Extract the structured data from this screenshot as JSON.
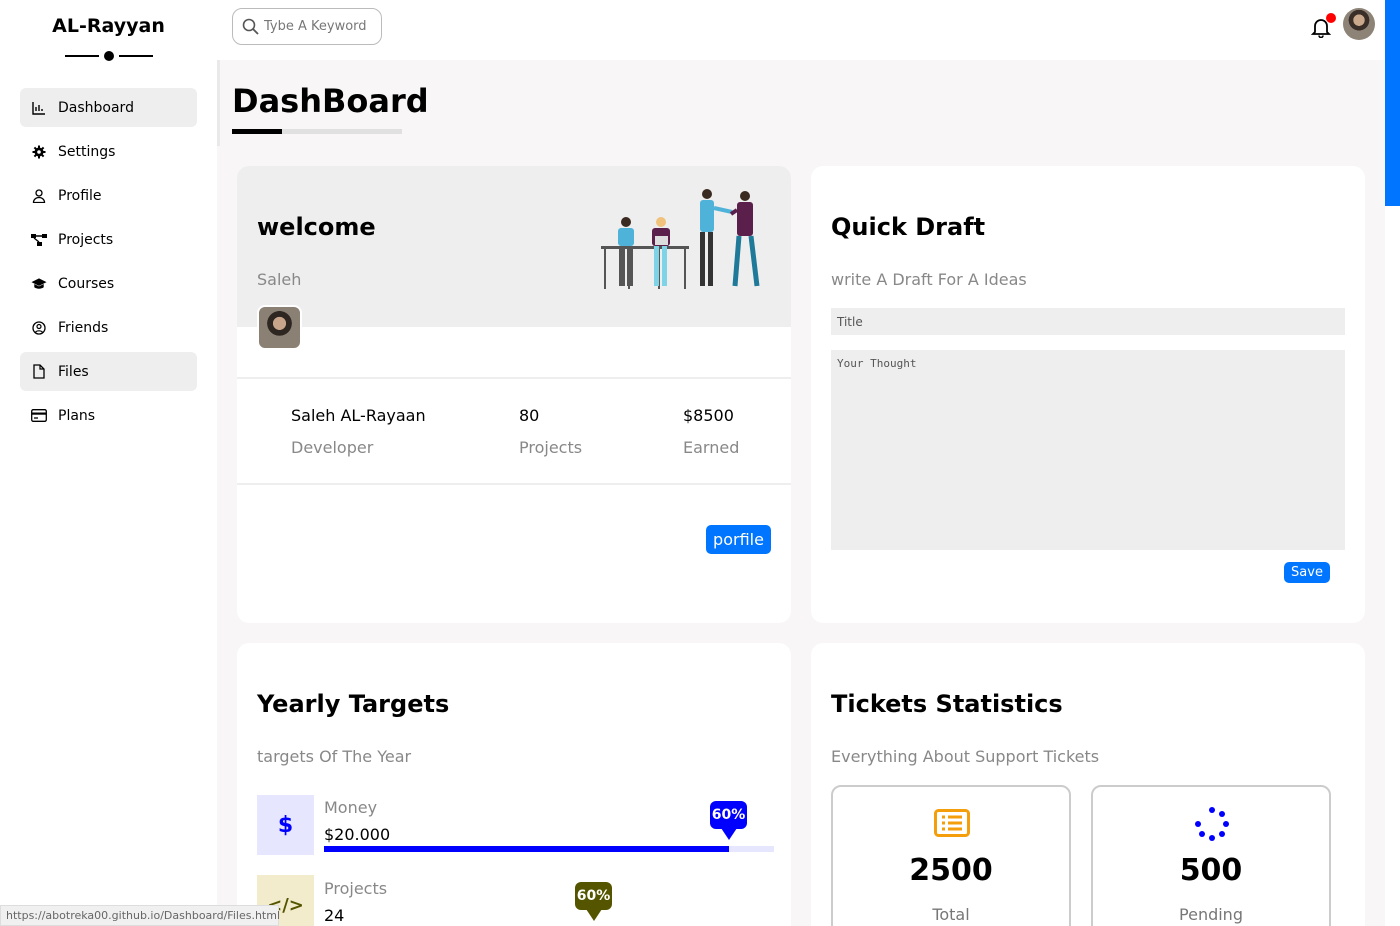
{
  "brand": {
    "name": "AL-Rayyan"
  },
  "sidebar": {
    "items": [
      {
        "label": "Dashboard",
        "icon": "chart-icon",
        "active": true
      },
      {
        "label": "Settings",
        "icon": "gear-icon",
        "active": false
      },
      {
        "label": "Profile",
        "icon": "user-icon",
        "active": false
      },
      {
        "label": "Projects",
        "icon": "diagram-icon",
        "active": false
      },
      {
        "label": "Courses",
        "icon": "graduation-cap-icon",
        "active": false
      },
      {
        "label": "Friends",
        "icon": "user-circle-icon",
        "active": false
      },
      {
        "label": "Files",
        "icon": "file-icon",
        "active": true
      },
      {
        "label": "Plans",
        "icon": "credit-card-icon",
        "active": false
      }
    ]
  },
  "header": {
    "search_placeholder": "Tybe A Keyword"
  },
  "page": {
    "title": "DashBoard"
  },
  "welcome": {
    "title": "welcome",
    "name": "Saleh",
    "full_name": "Saleh AL-Rayaan",
    "role": "Developer",
    "projects_value": "80",
    "projects_label": "Projects",
    "earned_value": "$8500",
    "earned_label": "Earned",
    "button_label": "porfile"
  },
  "draft": {
    "title": "Quick Draft",
    "subtitle": "write A Draft For A Ideas",
    "title_placeholder": "Title",
    "thought_placeholder": "Your Thought",
    "save_label": "Save"
  },
  "targets": {
    "title": "Yearly Targets",
    "subtitle": "targets Of The Year",
    "items": [
      {
        "label": "Money",
        "value": "$20.000",
        "percent_label": "60%",
        "fill": 0.9,
        "color": "#0000ff",
        "bg": "#e6e6ff"
      },
      {
        "label": "Projects",
        "value": "24",
        "percent_label": "60%",
        "fill": 0.6,
        "color": "#555500",
        "bg": "#f2eccc"
      }
    ]
  },
  "tickets": {
    "title": "Tickets Statistics",
    "subtitle": "Everything About Support Tickets",
    "items": [
      {
        "value": "2500",
        "label": "Total",
        "icon": "list-icon",
        "color": "#f59e0b"
      },
      {
        "value": "500",
        "label": "Pending",
        "icon": "spinner-icon",
        "color": "#0000ff"
      }
    ]
  },
  "statusbar": {
    "url": "https://abotreka00.github.io/Dashboard/Files.html"
  }
}
